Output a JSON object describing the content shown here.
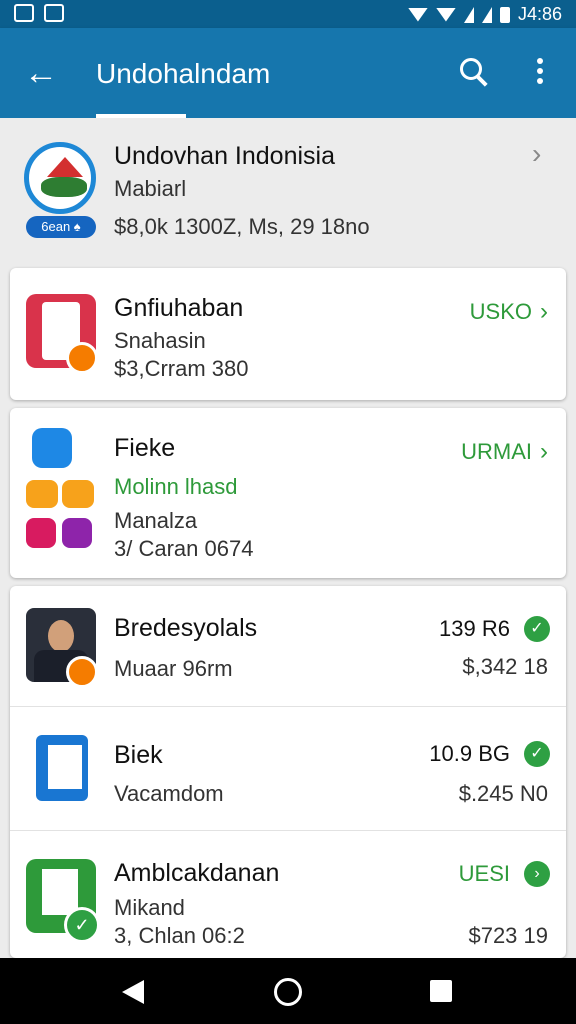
{
  "status": {
    "time": "J4:86"
  },
  "appbar": {
    "title": "Undohalndam"
  },
  "header": {
    "title": "Undovhan Indonisia",
    "subtitle": "Mabiarl",
    "meta": "$8,0k 1300Z, Ms, 29 18no",
    "badge": "6ean ♠"
  },
  "items": [
    {
      "title": "Gnfiuhaban",
      "line1": "Snahasin",
      "line2": "$3,Crram 380",
      "right": "USKO"
    },
    {
      "title": "Fieke",
      "line1": "Molinn lhasd",
      "line2": "Manalza",
      "line3": "3/ Caran 0674",
      "right": "URMAI"
    }
  ],
  "list": [
    {
      "title": "Bredesyolals",
      "sub": "Muaar 96rm",
      "right_top": "139 R6",
      "right_bottom": "$,342 18"
    },
    {
      "title": "Biek",
      "sub": "Vacamdom",
      "right_top": "10.9 BG",
      "right_bottom": "$.245 N0"
    },
    {
      "title": "Amblcakdanan",
      "sub1": "Mikand",
      "sub2": "3, Chlan 06:2",
      "right_top": "UESI",
      "right_bottom": "$723 19"
    }
  ],
  "colors": {
    "accent": "#1676ad",
    "green": "#2e9a3a"
  }
}
